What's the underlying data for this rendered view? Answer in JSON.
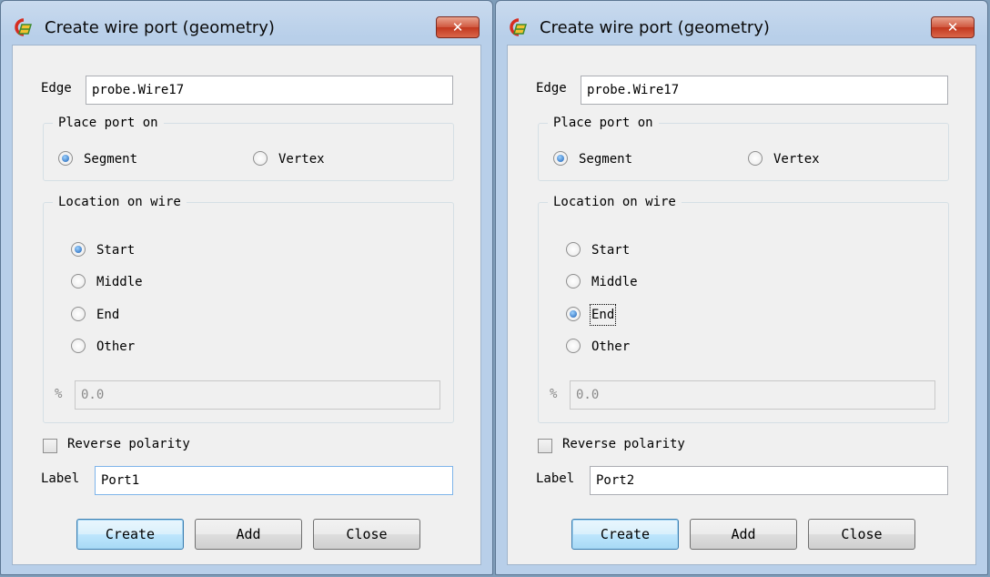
{
  "colors": {
    "title_bar": "#b8cfe9",
    "close_button": "#c8452e",
    "client_bg": "#f0f0f0",
    "default_button": "#bee6fd"
  },
  "dialogs": [
    {
      "title": "Create wire port (geometry)",
      "edge_label": "Edge",
      "edge_value": "probe.Wire17",
      "place_port_on": {
        "title": "Place port on",
        "options": [
          "Segment",
          "Vertex"
        ],
        "selected": "Segment"
      },
      "location_on_wire": {
        "title": "Location on wire",
        "options": [
          "Start",
          "Middle",
          "End",
          "Other"
        ],
        "selected": "Start",
        "percent_label": "%",
        "percent_value": "0.0"
      },
      "reverse_polarity": {
        "label": "Reverse polarity",
        "checked": false
      },
      "label_label": "Label",
      "label_value": "Port1",
      "buttons": {
        "create": "Create",
        "add": "Add",
        "close": "Close"
      }
    },
    {
      "title": "Create wire port (geometry)",
      "edge_label": "Edge",
      "edge_value": "probe.Wire17",
      "place_port_on": {
        "title": "Place port on",
        "options": [
          "Segment",
          "Vertex"
        ],
        "selected": "Segment"
      },
      "location_on_wire": {
        "title": "Location on wire",
        "options": [
          "Start",
          "Middle",
          "End",
          "Other"
        ],
        "selected": "End",
        "percent_label": "%",
        "percent_value": "0.0"
      },
      "reverse_polarity": {
        "label": "Reverse polarity",
        "checked": false
      },
      "label_label": "Label",
      "label_value": "Port2",
      "buttons": {
        "create": "Create",
        "add": "Add",
        "close": "Close"
      }
    }
  ]
}
